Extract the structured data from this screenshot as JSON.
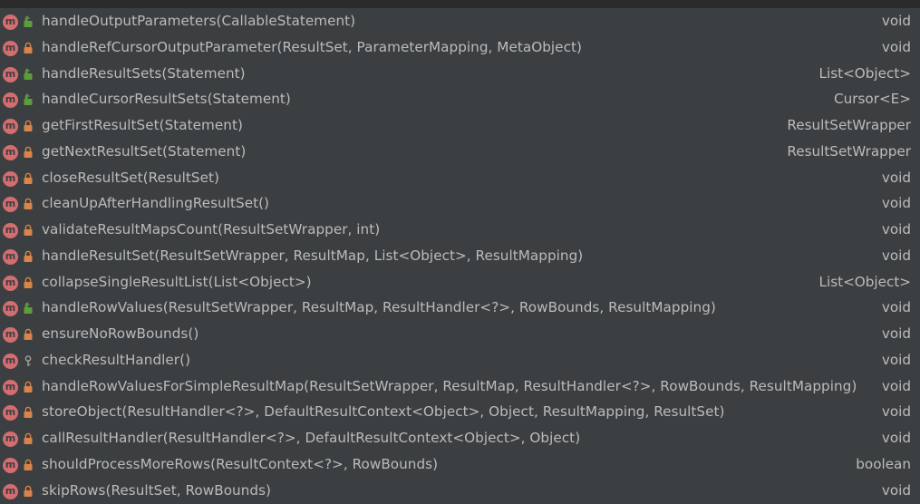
{
  "colors": {
    "background": "#3c3f41",
    "text": "#bbbbbb",
    "method_badge": "#d46d6f",
    "public_unlock": "#5c9e3c",
    "private_lock": "#d9844a",
    "package_icon": "#a0a0a0"
  },
  "method_badge_glyph": "m",
  "methods": [
    {
      "signature": "handleOutputParameters(CallableStatement)",
      "return_type": "void",
      "visibility": "public",
      "icon": "unlocked-icon"
    },
    {
      "signature": "handleRefCursorOutputParameter(ResultSet, ParameterMapping, MetaObject)",
      "return_type": "void",
      "visibility": "private",
      "icon": "lock-icon"
    },
    {
      "signature": "handleResultSets(Statement)",
      "return_type": "List<Object>",
      "visibility": "public",
      "icon": "unlocked-icon"
    },
    {
      "signature": "handleCursorResultSets(Statement)",
      "return_type": "Cursor<E>",
      "visibility": "public",
      "icon": "unlocked-icon"
    },
    {
      "signature": "getFirstResultSet(Statement)",
      "return_type": "ResultSetWrapper",
      "visibility": "private",
      "icon": "lock-icon"
    },
    {
      "signature": "getNextResultSet(Statement)",
      "return_type": "ResultSetWrapper",
      "visibility": "private",
      "icon": "lock-icon"
    },
    {
      "signature": "closeResultSet(ResultSet)",
      "return_type": "void",
      "visibility": "private",
      "icon": "lock-icon"
    },
    {
      "signature": "cleanUpAfterHandlingResultSet()",
      "return_type": "void",
      "visibility": "private",
      "icon": "lock-icon"
    },
    {
      "signature": "validateResultMapsCount(ResultSetWrapper, int)",
      "return_type": "void",
      "visibility": "private",
      "icon": "lock-icon"
    },
    {
      "signature": "handleResultSet(ResultSetWrapper, ResultMap, List<Object>, ResultMapping)",
      "return_type": "void",
      "visibility": "private",
      "icon": "lock-icon"
    },
    {
      "signature": "collapseSingleResultList(List<Object>)",
      "return_type": "List<Object>",
      "visibility": "private",
      "icon": "lock-icon"
    },
    {
      "signature": "handleRowValues(ResultSetWrapper, ResultMap, ResultHandler<?>, RowBounds, ResultMapping)",
      "return_type": "void",
      "visibility": "public",
      "icon": "unlocked-icon"
    },
    {
      "signature": "ensureNoRowBounds()",
      "return_type": "void",
      "visibility": "private",
      "icon": "lock-icon"
    },
    {
      "signature": "checkResultHandler()",
      "return_type": "void",
      "visibility": "package",
      "icon": "package-icon"
    },
    {
      "signature": "handleRowValuesForSimpleResultMap(ResultSetWrapper, ResultMap, ResultHandler<?>, RowBounds, ResultMapping)",
      "return_type": "void",
      "visibility": "private",
      "icon": "lock-icon"
    },
    {
      "signature": "storeObject(ResultHandler<?>, DefaultResultContext<Object>, Object, ResultMapping, ResultSet)",
      "return_type": "void",
      "visibility": "private",
      "icon": "lock-icon"
    },
    {
      "signature": "callResultHandler(ResultHandler<?>, DefaultResultContext<Object>, Object)",
      "return_type": "void",
      "visibility": "private",
      "icon": "lock-icon"
    },
    {
      "signature": "shouldProcessMoreRows(ResultContext<?>, RowBounds)",
      "return_type": "boolean",
      "visibility": "private",
      "icon": "lock-icon"
    },
    {
      "signature": "skipRows(ResultSet, RowBounds)",
      "return_type": "void",
      "visibility": "private",
      "icon": "lock-icon"
    }
  ]
}
